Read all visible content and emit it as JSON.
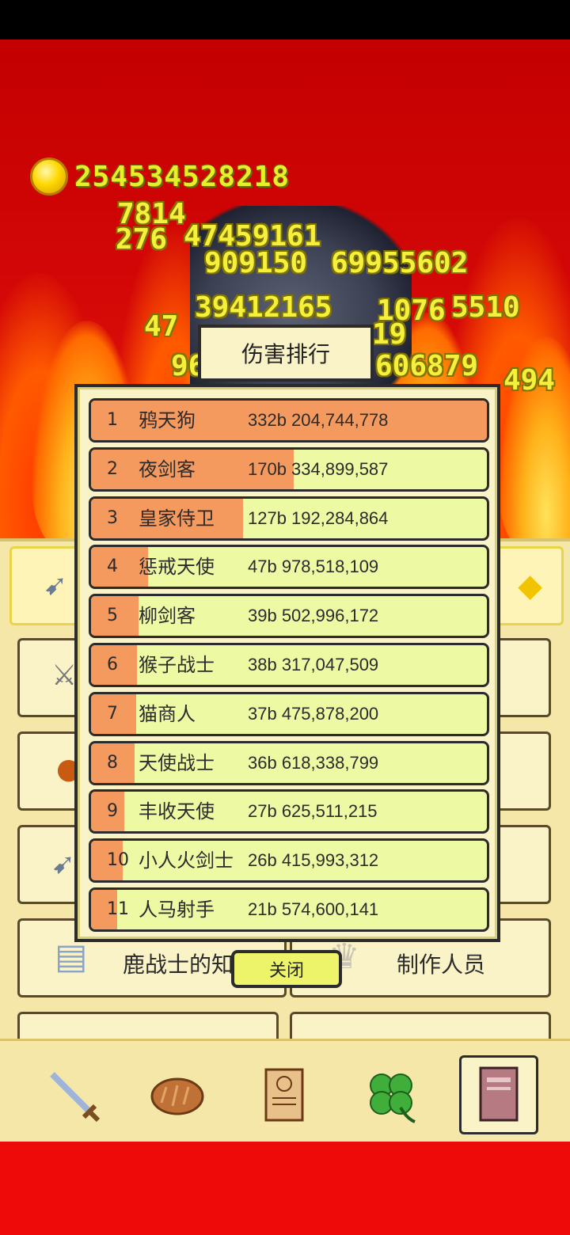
{
  "coins": "25453452821 8",
  "coins_display": "254534528218",
  "floating_damage": [
    "7814",
    "276",
    "47459161",
    "909150",
    "69955602",
    "39412165",
    "1076",
    "5510",
    "47",
    "19",
    "96",
    "606879",
    "494"
  ],
  "dialog": {
    "title": "伤害排行",
    "close_label": "关闭",
    "rows": [
      {
        "rank": "1",
        "name": "鸦天狗",
        "damage": "332b 204,744,778",
        "share": 1.0
      },
      {
        "rank": "2",
        "name": "夜剑客",
        "damage": "170b 334,899,587",
        "share": 0.512
      },
      {
        "rank": "3",
        "name": "皇家侍卫",
        "damage": "127b 192,284,864",
        "share": 0.384
      },
      {
        "rank": "4",
        "name": "惩戒天使",
        "damage": "47b 978,518,109",
        "share": 0.144
      },
      {
        "rank": "5",
        "name": "柳剑客",
        "damage": "39b 502,996,172",
        "share": 0.119
      },
      {
        "rank": "6",
        "name": "猴子战士",
        "damage": "38b 317,047,509",
        "share": 0.115
      },
      {
        "rank": "7",
        "name": "猫商人",
        "damage": "37b 475,878,200",
        "share": 0.113
      },
      {
        "rank": "8",
        "name": "天使战士",
        "damage": "36b 618,338,799",
        "share": 0.11
      },
      {
        "rank": "9",
        "name": "丰收天使",
        "damage": "27b 625,511,215",
        "share": 0.083
      },
      {
        "rank": "10",
        "name": "小人火剑士",
        "damage": "26b 415,993,312",
        "share": 0.08
      },
      {
        "rank": "11",
        "name": "人马射手",
        "damage": "21b 574,600,141",
        "share": 0.065
      }
    ]
  },
  "background": {
    "knowledge_label": "鹿战士的知识",
    "credits_label": "制作人员"
  },
  "nav": [
    "sword-icon",
    "bread-icon",
    "scroll-icon",
    "clover-icon",
    "book-icon"
  ],
  "colors": {
    "bar_fill": "#f59a5e",
    "row_bg": "#eef9a4",
    "panel": "#fbf3c8"
  }
}
